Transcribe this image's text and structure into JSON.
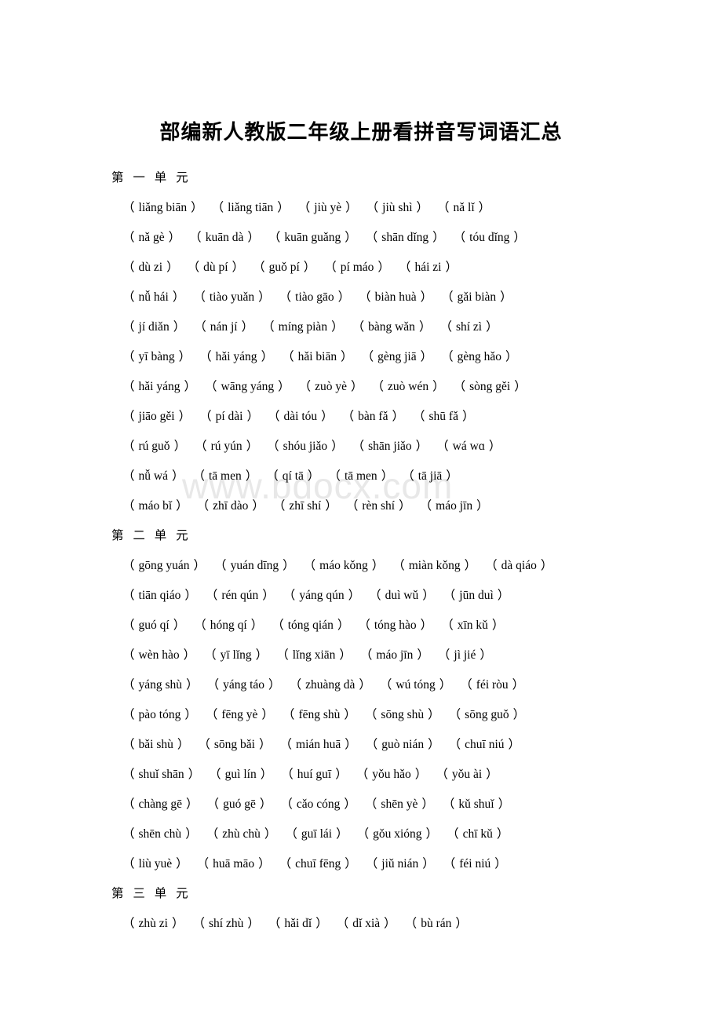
{
  "document": {
    "title": "部编新人教版二年级上册看拼音写词语汇总",
    "watermark": "www.bdocx.com"
  },
  "sections": [
    {
      "heading": "第 一 单 元",
      "rows": [
        [
          "liǎng biān",
          "liǎng tiān",
          "jiù yè",
          "jiù shì",
          "nǎ lǐ"
        ],
        [
          "nǎ gè",
          "kuān dà",
          "kuān guǎng",
          "shān dǐng",
          "tóu dǐng"
        ],
        [
          "dù zi",
          "dù pí",
          "guǒ pí",
          "pí máo",
          "hái zi"
        ],
        [
          "nǚ hái",
          "tiào yuǎn",
          "tiào gāo",
          "biàn huà",
          "gǎi biàn"
        ],
        [
          "jí diǎn",
          "nán jí",
          "míng piàn",
          "bàng wǎn",
          "shí zì"
        ],
        [
          "yī bàng",
          "hǎi yáng",
          "hǎi biān",
          "gèng jiā",
          "gèng hǎo"
        ],
        [
          "hǎi yáng",
          "wāng yáng",
          "zuò yè",
          "zuò wén",
          "sòng gěi"
        ],
        [
          "jiāo gěi",
          "pí dài",
          "dài tóu",
          "bàn fǎ",
          "shū fǎ"
        ],
        [
          "rú guǒ",
          "rú yún",
          "shóu jiǎo",
          "shān jiǎo",
          "wá wɑ"
        ],
        [
          "nǚ wá",
          "tā men",
          "qí tā",
          "tā men",
          "tā jiā"
        ],
        [
          "máo bǐ",
          "zhī dào",
          "zhī shí",
          "rèn shí",
          "máo jīn"
        ]
      ]
    },
    {
      "heading": "第 二 单 元",
      "rows": [
        [
          "gōng yuán",
          "yuán dīng",
          "máo kǒng",
          "miàn kǒng",
          "dà qiáo"
        ],
        [
          "tiān qiáo",
          "rén qún",
          "yáng qún",
          "duì wǔ",
          "jūn duì"
        ],
        [
          "guó qí",
          "hóng qí",
          "tóng qián",
          "tóng hào",
          "xīn kǔ"
        ],
        [
          "wèn hào",
          "yī lǐng",
          "lǐng xiān",
          "máo jīn",
          "jì jié"
        ],
        [
          "yáng shù",
          "yáng táo",
          "zhuàng dà",
          "wú tóng",
          "féi ròu"
        ],
        [
          "pào tóng",
          "fēng yè",
          "fēng shù",
          "sōng shù",
          "sōng guǒ"
        ],
        [
          "bǎi shù",
          "sōng bǎi",
          "mián huā",
          "guò nián",
          "chuī niú"
        ],
        [
          "shuǐ shān",
          "guì lín",
          "huí guī",
          "yǒu hǎo",
          "yǒu ài"
        ],
        [
          "chàng gē",
          "guó gē",
          "cǎo cóng",
          "shēn yè",
          "kǔ shuǐ"
        ],
        [
          "shēn chù",
          "zhù chù",
          "guī lái",
          "gǒu xióng",
          "chī kǔ"
        ],
        [
          "liù yuè",
          "huā māo",
          "chuī fēng",
          "jiǔ nián",
          "féi niú"
        ]
      ]
    },
    {
      "heading": "第 三 单 元",
      "rows": [
        [
          "zhù zi",
          "shí zhù",
          "hǎi dǐ",
          "dǐ xià",
          "bù rán"
        ]
      ]
    }
  ]
}
